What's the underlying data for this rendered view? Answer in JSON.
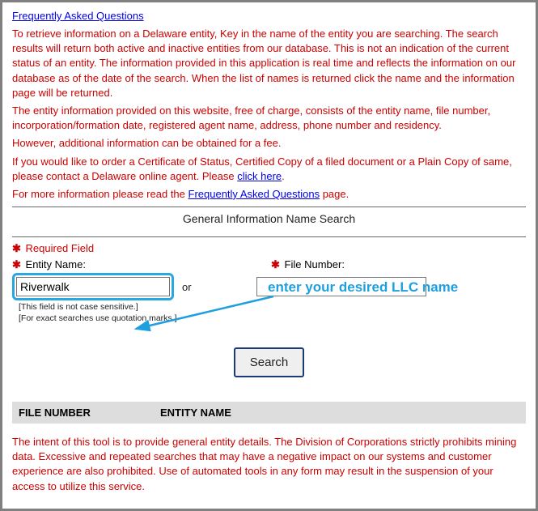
{
  "faq_link": "Frequently Asked Questions",
  "para1": "To retrieve information on a Delaware entity, Key in the name of the entity you are searching. The search results will return both active and inactive entities from our database. This is not an indication of the current status of an entity. The information provided in this application is real time and reflects the information on our database as of the date of the search. When the list of names is returned click the name and the information page will be returned.",
  "para2": "The entity information provided on this website, free of charge, consists of the entity name, file number, incorporation/formation date, registered agent name, address, phone number and residency.",
  "para3": "However, additional information can be obtained for a fee.",
  "para4_prefix": "If you would like to order a Certificate of Status, Certified Copy of a filed document or a Plain Copy of same, please contact a Delaware online agent. Please ",
  "para4_link": "click here",
  "para4_suffix": ".",
  "para5_prefix": "For more information please read the ",
  "para5_link": "Frequently Asked Questions",
  "para5_suffix": " page.",
  "search_title": "General Information Name Search",
  "required_field": "Required Field",
  "entity_name_label": "Entity Name:",
  "file_number_label": "File Number:",
  "entity_name_value": "Riverwalk",
  "file_number_value": "",
  "or_text": "or",
  "hint1": "[This field is not case sensitive.]",
  "hint2": "[For exact searches use quotation marks.]",
  "search_button": "Search",
  "th_filenum": "FILE NUMBER",
  "th_entname": "ENTITY NAME",
  "footer_text": "The intent of this tool is to provide general entity details. The Division of Corporations strictly prohibits mining data. Excessive and repeated searches that may have a negative impact on our systems and customer experience are also prohibited. Use of automated tools in any form may result in the suspension of your access to utilize this service.",
  "annotation": "enter your desired LLC name",
  "asterisk": "✱"
}
